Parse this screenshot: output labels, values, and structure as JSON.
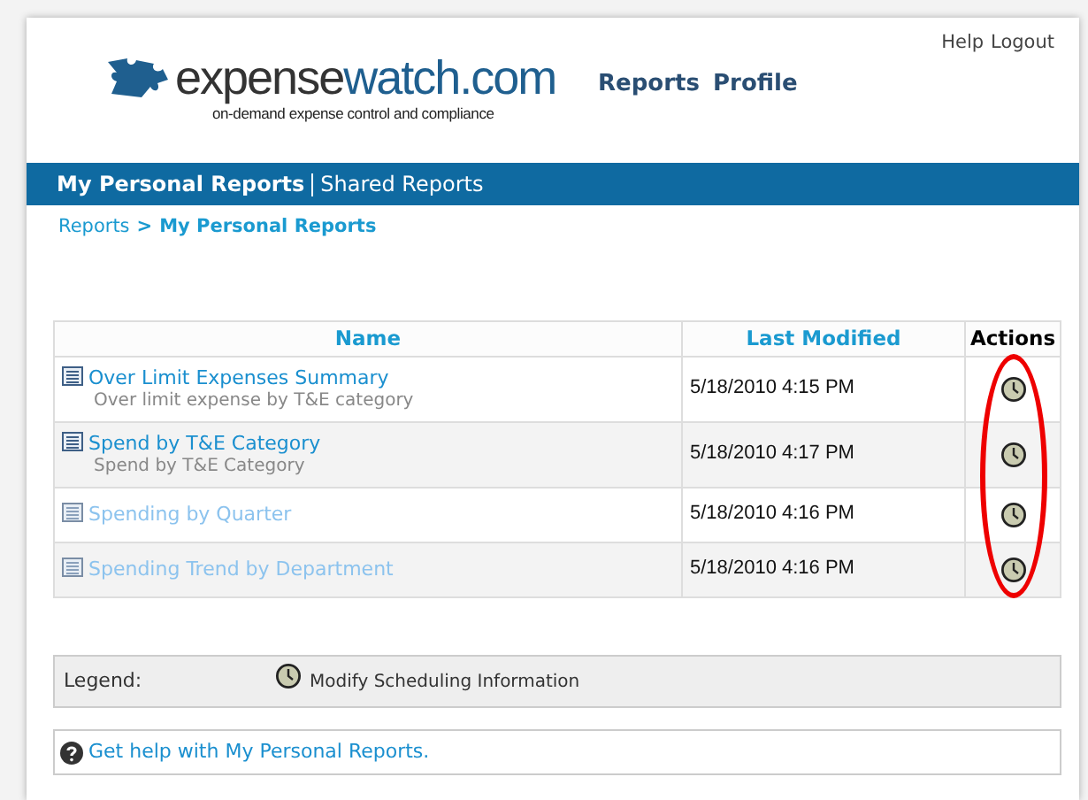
{
  "header": {
    "logo": {
      "part_1": "expense",
      "part_2": "watch.com",
      "tagline": "on-demand expense control and compliance"
    },
    "nav": [
      "Reports",
      "Profile"
    ],
    "utility_links": [
      "Help",
      "Logout"
    ]
  },
  "subnav": [
    {
      "label": "My Personal Reports",
      "selected": true
    },
    {
      "label": "Shared Reports",
      "selected": false
    }
  ],
  "breadcrumb": {
    "parent": "Reports",
    "separator": ">",
    "current": "My Personal Reports"
  },
  "table": {
    "columns": [
      "Name",
      "Last Modified",
      "Actions"
    ],
    "highlight_actions": true,
    "rows": [
      {
        "name": "Over Limit Expenses Summary",
        "description": "Over limit expense by T&E category",
        "last_modified": "5/18/2010 4:15 PM",
        "dimmed": false
      },
      {
        "name": "Spend by T&E Category",
        "description": "Spend by T&E Category",
        "last_modified": "5/18/2010 4:17 PM",
        "dimmed": false
      },
      {
        "name": "Spending by Quarter",
        "last_modified": "5/18/2010 4:16 PM",
        "dimmed": true
      },
      {
        "name": "Spending Trend by Department",
        "last_modified": "5/18/2010 4:16 PM",
        "dimmed": true
      }
    ]
  },
  "legend": {
    "label": "Legend:",
    "items": [
      "Modify Scheduling Information"
    ]
  },
  "help": {
    "link": "Get help with My Personal Reports."
  }
}
